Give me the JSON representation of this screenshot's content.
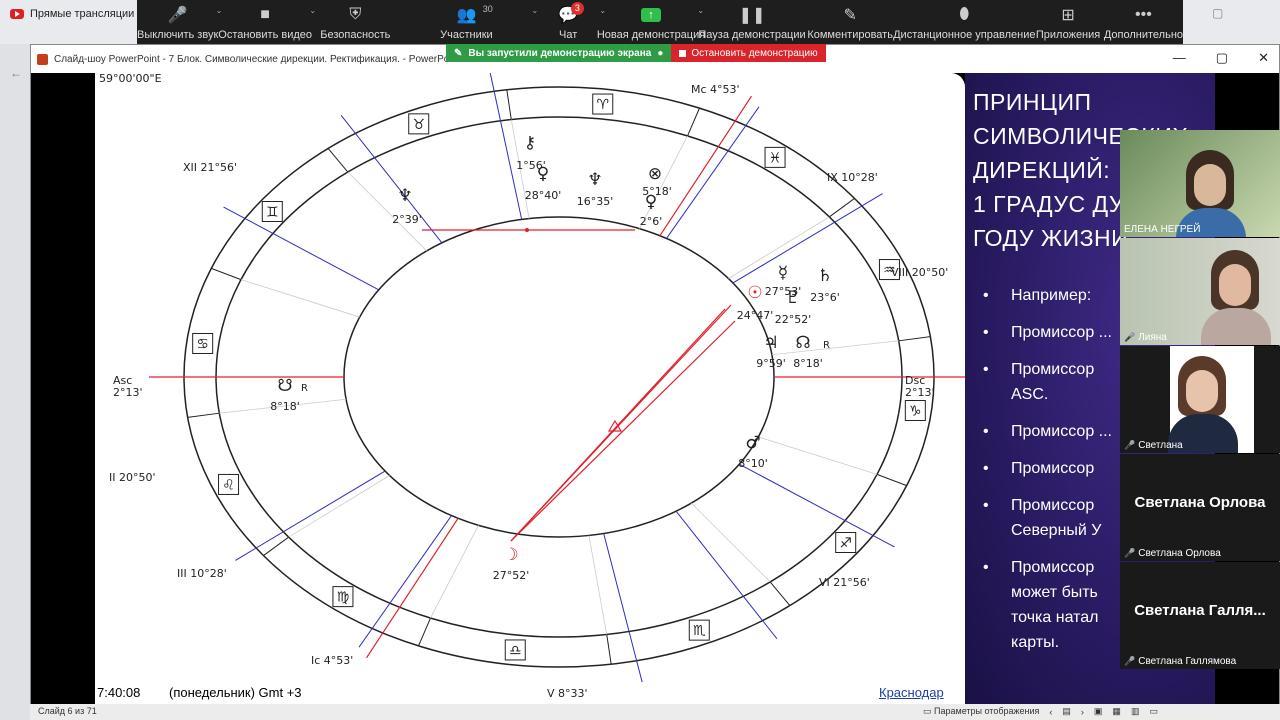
{
  "browser": {
    "tab_title": "Прямые трансляции -",
    "extra_icon": "▢"
  },
  "toolbar": {
    "items": [
      {
        "label": "Выключить звук",
        "icon": "mic-icon"
      },
      {
        "label": "Остановить видео",
        "icon": "video-icon"
      },
      {
        "label": "Безопасность",
        "icon": "shield-icon"
      },
      {
        "label": "Участники",
        "icon": "participants-icon",
        "count": "30"
      },
      {
        "label": "Чат",
        "icon": "chat-icon",
        "badge": "3"
      },
      {
        "label": "Новая демонстрация",
        "icon": "share-screen-icon"
      },
      {
        "label": "Пауза демонстрации",
        "icon": "pause-icon"
      },
      {
        "label": "Комментировать",
        "icon": "pencil-icon"
      },
      {
        "label": "Дистанционное управление",
        "icon": "mouse-icon"
      },
      {
        "label": "Приложения",
        "icon": "apps-icon"
      },
      {
        "label": "Дополнительно",
        "icon": "more-icon"
      }
    ]
  },
  "banner": {
    "sharing": "Вы запустили демонстрацию экрана",
    "stop": "Остановить демонстрацию"
  },
  "window": {
    "title": "Слайд-шоу PowerPoint  -  7 Блок. Символические дирекции. Ректификация. - PowerPo"
  },
  "chart": {
    "corner": "59°00'00\"E",
    "houses": {
      "mc": "Mc 4°53'",
      "ix": "IX 10°28'",
      "viii": "VIII 20°50'",
      "xii": "XII 21°56'",
      "dsc": "Dsc",
      "dsc_deg": "2°13'",
      "asc": "Asc",
      "asc_deg": "2°13'",
      "ii": "II 20°50'",
      "iii": "III 10°28'",
      "ic": "Ic 4°53'",
      "v": "V 8°33'",
      "vi": "VI 21°56'"
    },
    "planets": {
      "chiron": "1°56'",
      "venus": "28°40'",
      "neptune": "16°35'",
      "pluto": "5°18'",
      "mercury": "2°6'",
      "uranus": "2°39'",
      "mercury2": "27°53'",
      "saturn": "23°6'",
      "sun": "24°47'",
      "pluto2": "22°52'",
      "jupiter": "9°59'",
      "node": "8°18'",
      "node_r": "R",
      "node2": "8°18'",
      "node2_r": "R",
      "mars": "8°10'",
      "moon": "27°52'"
    }
  },
  "slide_footer": {
    "time": "7:40:08",
    "text": "(понедельник) Gmt +3",
    "city": "Краснодар"
  },
  "slide_text": {
    "heading": [
      "ПРИНЦИП",
      "СИМВОЛИЧЕСКИХ",
      "ДИРЕКЦИЙ:",
      "1 ГРАДУС ДУ",
      "ГОДУ ЖИЗНИ"
    ],
    "bullets": [
      "Например:",
      "Промиссор ...",
      "Промиссор",
      "ASC.",
      "Промиссор ...",
      "Промиссор",
      "Промиссор",
      "Северный У",
      "Промиссор",
      "может быть",
      "точка натал",
      "карты."
    ]
  },
  "participants": [
    {
      "name": "ЕЛЕНА НЕГРЕЙ",
      "muted": false
    },
    {
      "name": "Лияна",
      "muted": true
    },
    {
      "name": "Светлана",
      "muted": true
    },
    {
      "name": "Светлана Орлова",
      "big": "Светлана Орлова",
      "muted": true
    },
    {
      "name": "Светлана Галлямова",
      "big": "Светлана  Галля...",
      "muted": true
    }
  ],
  "statusbar": {
    "slide": "Слайд 6 из 71",
    "display_settings": "Параметры отображения"
  },
  "colors": {
    "toolbar_bg": "#1e1e1e",
    "banner_green": "#2e9c45",
    "banner_red": "#d9242b",
    "chart_red": "#e0202a",
    "chart_blue": "#2d2dbf",
    "slide_purple": "#2a1b63"
  }
}
